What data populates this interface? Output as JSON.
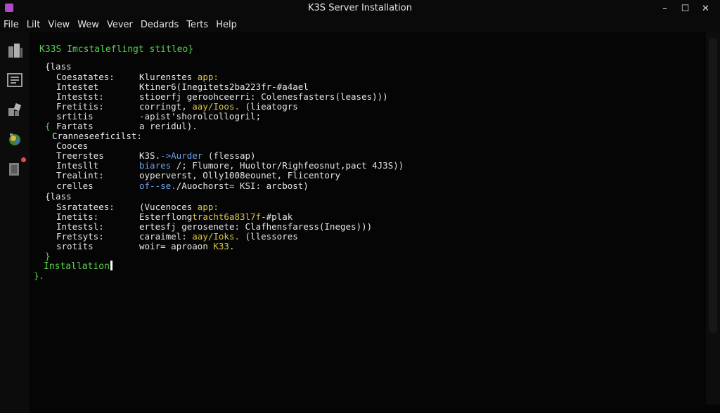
{
  "window": {
    "title": "K3S Server Installation",
    "controls": {
      "minimize": "–",
      "maximize": "☐",
      "close": "✕"
    }
  },
  "menu": [
    "File",
    "Lilt",
    "View",
    "Wew",
    "Vever",
    "Dedards",
    "Terts",
    "Help"
  ],
  "sidebar_icons": [
    "files-icon",
    "list-icon",
    "extensions-icon",
    "debug-icon",
    "notifications-icon"
  ],
  "editor": {
    "header": "K33S Imcstaleflingt stitleo}",
    "block1": {
      "open": "{lass",
      "rows": [
        {
          "key": "Coesatates:",
          "value_a": "Klurenstes ",
          "value_b": "app:"
        },
        {
          "key": "Intestet",
          "value_a": "Ktiner6(Inegitets2ba223fr-#a4ael",
          "value_b": ""
        },
        {
          "key": "Intestst:",
          "value_a": "stioerfj geroohceerri: Colenesfasters(leases)))",
          "value_b": ""
        },
        {
          "key": "Fretitis:",
          "value_a": "corringt, ",
          "value_b": "aay/Ioos.",
          "value_c": " (lieatogrs"
        },
        {
          "key": "srtitis",
          "value_a": "-apist'shorolcollogril;",
          "value_b": ""
        }
      ],
      "fartats_key": "Fartats",
      "fartats_value": "a reridul).",
      "subhead": "Cranneseeficilst:"
    },
    "block2": {
      "rows": [
        {
          "key": "Cooces",
          "value_a": ""
        },
        {
          "key": "Treerstes",
          "value_a": "K3S.",
          "value_b": "->Aurder",
          "value_c": " (flessap)"
        },
        {
          "key": "Intesllt",
          "value_a": "biares",
          "value_b": " /; Flumore, Huoltor/Righfeosnut,pact 4J3S))"
        },
        {
          "key": "Trealint:",
          "value_a": "oyperverst, Olly1008eounet, Flicentory"
        },
        {
          "key": "crelles",
          "value_a": "of--se.",
          "value_b": "/Auochorst= KSI: arcbost)"
        }
      ]
    },
    "block3": {
      "open": "{lass",
      "rows": [
        {
          "key": "Ssratatees:",
          "value_a": "(Vucenoces ",
          "value_b": "app:"
        },
        {
          "key": "Inetits:",
          "value_a": "Esterflong",
          "value_b": "tracht6a83l7f",
          "value_c": "-#plak"
        },
        {
          "key": "Intestsl:",
          "value_a": "ertesfj ",
          "value_b": "gerosenete: Clafhensfaress(Ineges)))"
        },
        {
          "key": "Fretsyts:",
          "value_a": "caraimel: ",
          "value_b": "aay/Ioks.",
          "value_c": " (llessores"
        },
        {
          "key": "srotits",
          "value_a": "woir=",
          "value_b": " aproaon ",
          "value_c": "K33",
          "value_d": "."
        }
      ],
      "close": "}"
    },
    "footer_brace_open": "{",
    "installation": "Installation",
    "final_brace": "}."
  }
}
